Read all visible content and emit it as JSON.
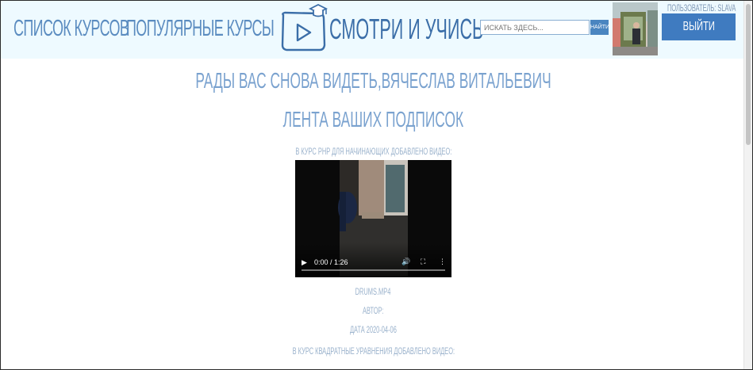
{
  "nav": {
    "courses_label": "Список курсов",
    "popular_label": "Популярные курсы"
  },
  "logo": {
    "text": "Смотри и учись"
  },
  "search": {
    "placeholder": "Искать здесь...",
    "button_label": "Найти"
  },
  "user": {
    "label": "Пользователь: slava",
    "logout_label": "Выйти"
  },
  "main": {
    "welcome": "Рады вас снова видеть,Вячеслав Витальевич",
    "feed_title": "Лента ваших подписок",
    "items": [
      {
        "announcement": "В курс PHP для начинающих добавлено видео:",
        "video": {
          "time": "0:00 / 1:26"
        },
        "filename": "drums.mp4",
        "author": "Автор:",
        "date": "Дата 2020-04-06"
      },
      {
        "announcement": "В курс Квадратные уравнения добавлено видео:"
      }
    ]
  },
  "colors": {
    "header_bg": "#eefaff",
    "link": "#5b8cc0",
    "accent": "#3f7bc0",
    "text_light": "#9ab2cc"
  },
  "icons": {
    "logo": "play-button-with-graduation-cap-icon",
    "video_play": "play-icon",
    "video_volume": "volume-icon",
    "video_fullscreen": "fullscreen-icon",
    "video_more": "more-vertical-icon"
  }
}
